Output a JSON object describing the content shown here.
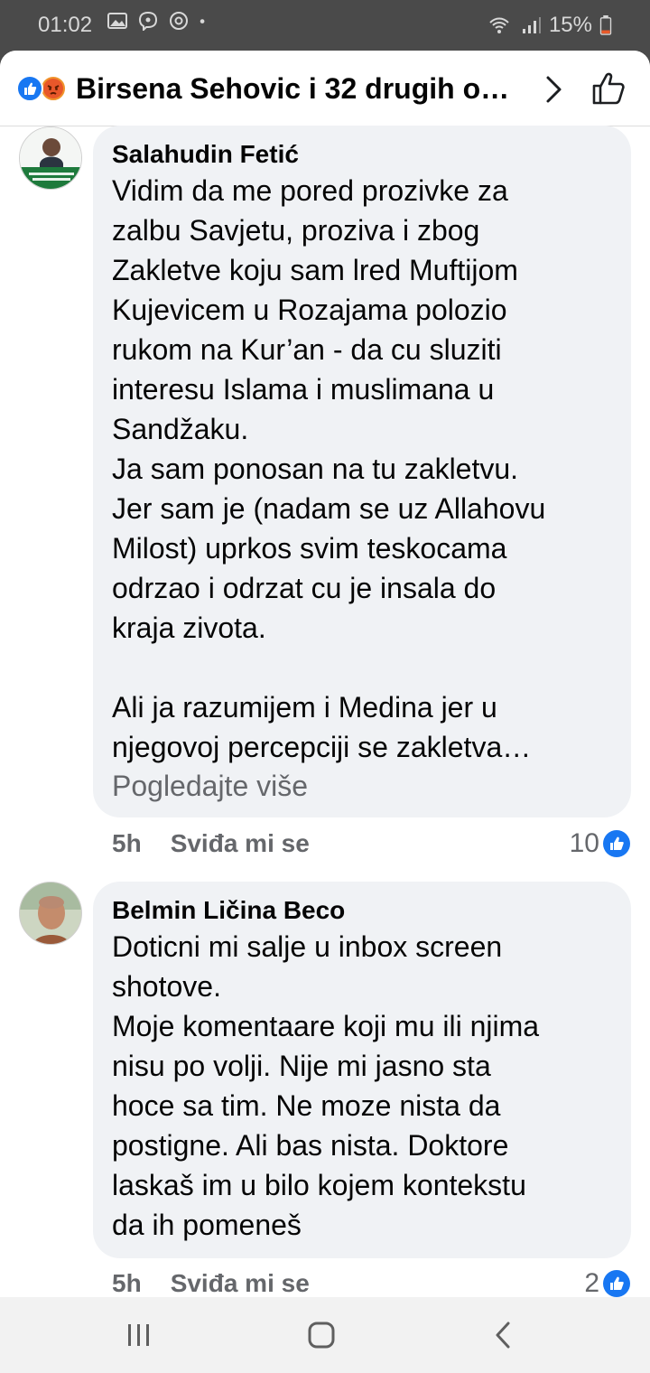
{
  "status_bar": {
    "time": "01:02",
    "battery": "15%",
    "icons": [
      "gallery-icon",
      "viber-icon",
      "messenger-icon",
      "dot-icon",
      "wifi-icon",
      "signal-icon",
      "battery-icon"
    ]
  },
  "header": {
    "title": "Birsena Sehovic i 32 drugih o…",
    "reaction_icons": [
      "like-reaction-icon",
      "angry-reaction-icon"
    ]
  },
  "comments": [
    {
      "author": "Salahudin Fetić",
      "text": "Vidim da me pored prozivke za\nzalbu Savjetu, proziva i zbog\nZakletve koju sam lred Muftijom\nKujevicem u Rozajama polozio\nrukom na Kur’an - da cu sluziti\ninteresu Islama i muslimana u\nSandžaku.\nJa sam ponosan na tu zakletvu.\nJer sam je (nadam se uz Allahovu\nMilost) uprkos svim teskocama\nodrzao i odrzat cu je insala do\nkraja zivota.\n\nAli ja razumijem i Medina jer u\nnjegovoj percepciji se zakletva…",
      "see_more": "Pogledajte više",
      "time": "5h",
      "like_label": "Sviđa mi se",
      "reactions": "10"
    },
    {
      "author": "Belmin Ličina Beco",
      "text": "Doticni mi salje u inbox screen\nshotove.\nMoje komentaare koji mu ili njima\nnisu po volji. Nije mi jasno sta\nhoce sa tim. Ne moze nista da\npostigne. Ali bas nista. Doktore\nlaskaš im u bilo kojem kontekstu\nda ih pomeneš",
      "time": "5h",
      "like_label": "Sviđa mi se",
      "reactions": "2"
    }
  ],
  "colors": {
    "accent": "#1877f2",
    "bubble": "#f0f2f5",
    "secondary_text": "#65676b",
    "status_bar": "#4a4a4a"
  }
}
